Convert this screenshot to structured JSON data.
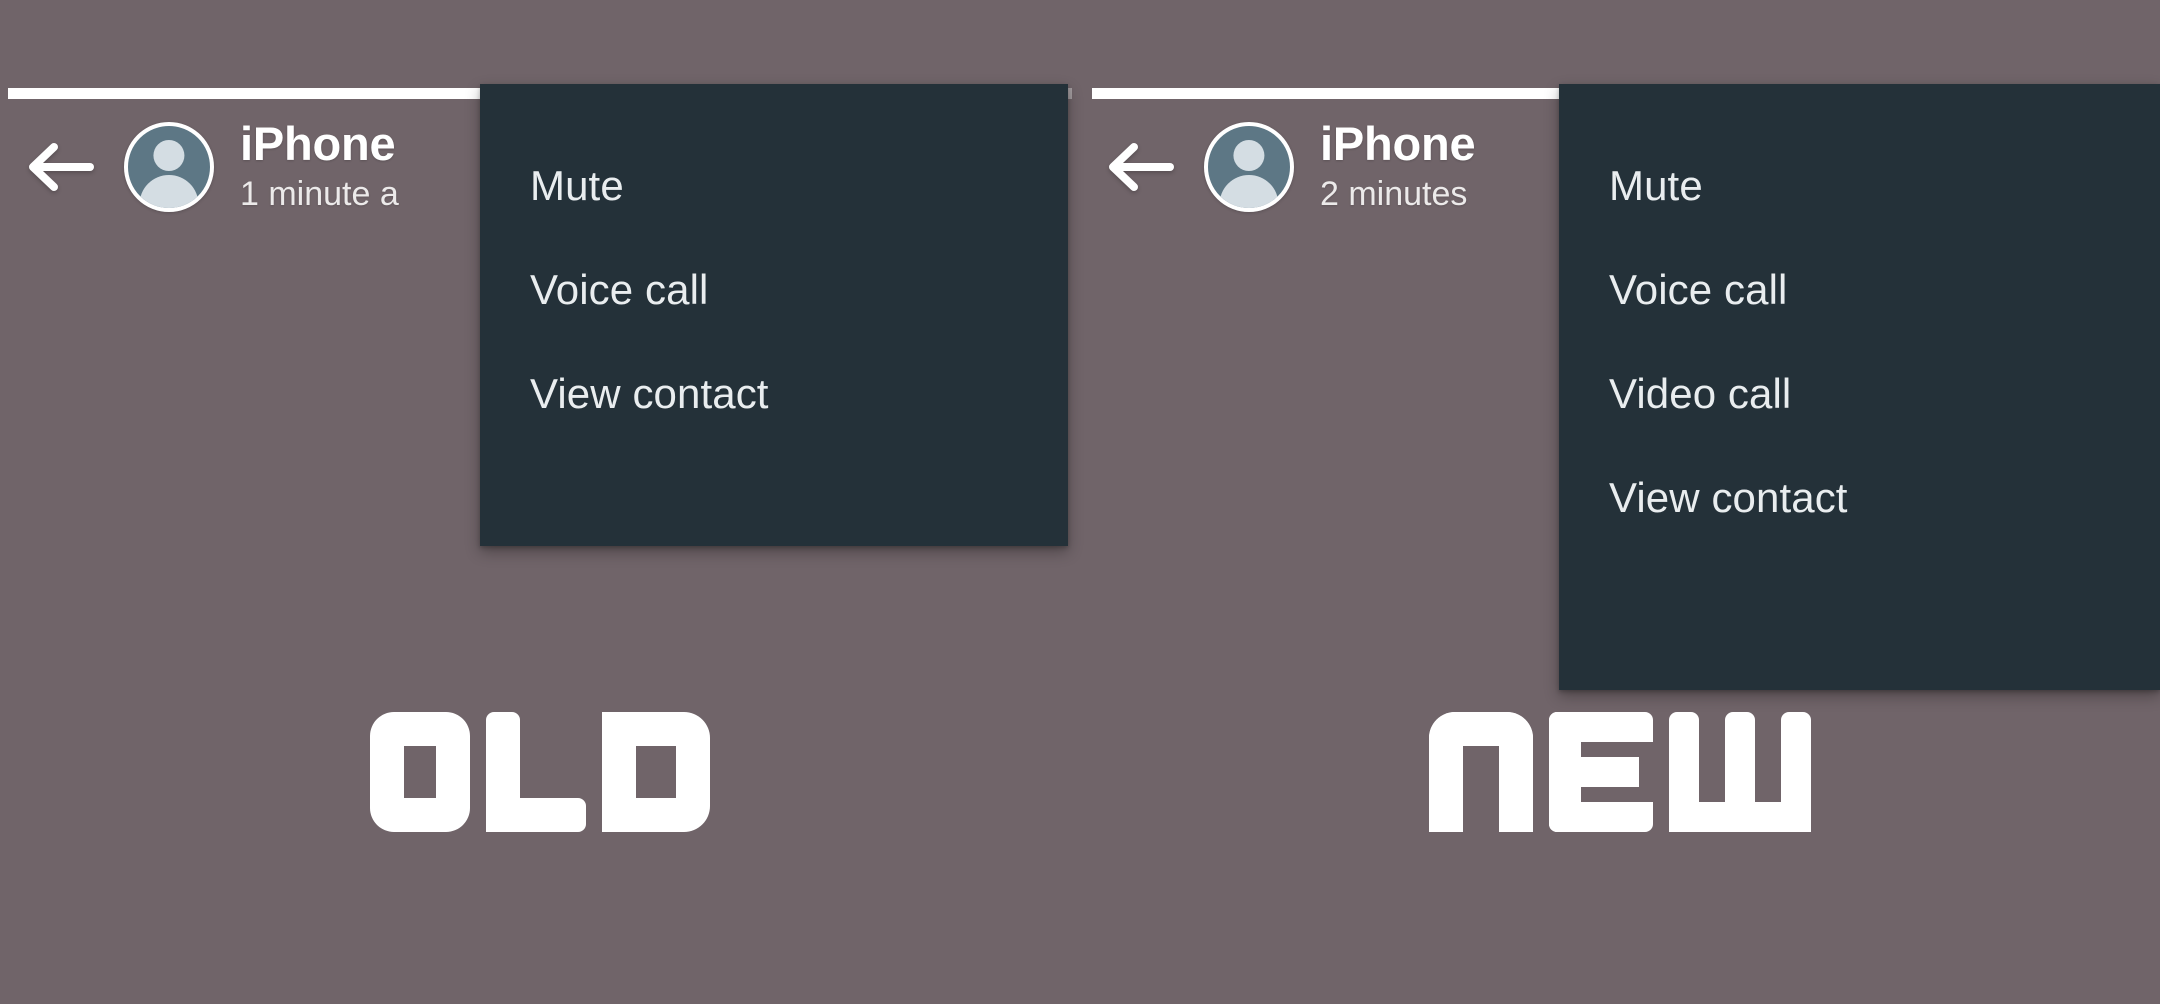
{
  "meta": {
    "background_color": "#706469",
    "menu_background_color": "#243139",
    "menu_text_color": "#e9edef",
    "accent_white": "#ffffff",
    "avatar_circle_color": "#5d7785",
    "avatar_person_color": "#d4dde3",
    "scrollbar_track_color": "#a49da0"
  },
  "panels": [
    {
      "id": "old",
      "badge_label": "OLD",
      "header": {
        "back_icon": "back-arrow-icon",
        "avatar_icon": "default-contact-avatar-icon",
        "contact_name": "iPhone",
        "contact_status": "1 minute a"
      },
      "scrollbar": {
        "value_percent": 84
      },
      "menu": {
        "items": [
          {
            "label": "Mute"
          },
          {
            "label": "Voice call"
          },
          {
            "label": "View contact"
          }
        ]
      }
    },
    {
      "id": "new",
      "badge_label": "new",
      "header": {
        "back_icon": "back-arrow-icon",
        "avatar_icon": "default-contact-avatar-icon",
        "contact_name": "iPhone",
        "contact_status": "2 minutes"
      },
      "scrollbar": {
        "value_percent": 97
      },
      "menu": {
        "items": [
          {
            "label": "Mute"
          },
          {
            "label": "Voice call"
          },
          {
            "label": "Video call"
          },
          {
            "label": "View contact"
          }
        ]
      }
    }
  ]
}
